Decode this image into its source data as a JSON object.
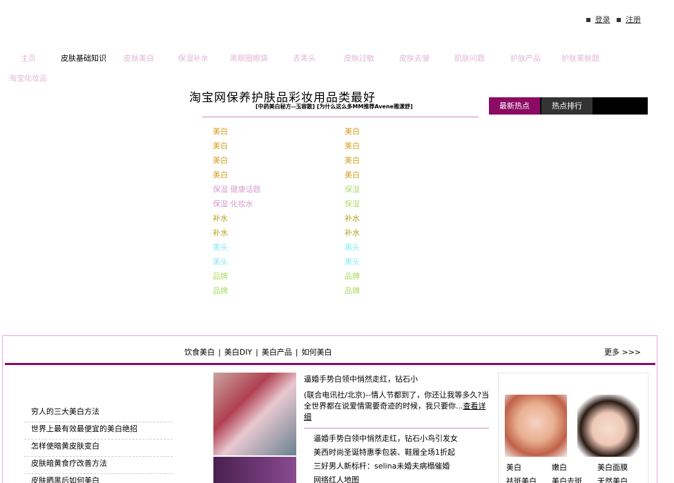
{
  "auth": {
    "login": "登录",
    "register": "注册"
  },
  "nav": {
    "items": [
      "主页",
      "皮肤基础知识",
      "皮肤美白",
      "保湿补水",
      "黑眼圈眼袋",
      "去黑头",
      "皮肤过敏",
      "皮肤去皱",
      "肌肤问题",
      "护肤产品",
      "护肤美肤题"
    ],
    "second_row": "淘宝化妆品"
  },
  "headline": {
    "title": "淘宝网保养护肤品彩妆用品类最好",
    "subtitle": "[中药美白秘方--玉容散] [为什么这么多MM推荐Avene雅漾舒]"
  },
  "hot_tabs": {
    "tab1": "最新热点",
    "tab2": "热点排行"
  },
  "columns": {
    "left": [
      "美白",
      "美白",
      "美白",
      "美白",
      "保湿  健康话题",
      "保湿  化妆水",
      "补水",
      "补水",
      "黑头",
      "黑头",
      "品牌",
      "品牌"
    ],
    "right": [
      "美白",
      "美白",
      "美白",
      "美白",
      "保湿",
      "保湿",
      "补水",
      "补水",
      "黑头",
      "黑头",
      "品牌",
      "品牌"
    ]
  },
  "colors": {
    "accent": "#8c0a63",
    "nav_text": "#e0b8d6",
    "border_pink": "#e4a8d8"
  },
  "panel": {
    "nav": [
      "饮食美白",
      "美白DIY",
      "美白产品",
      "如何美白"
    ],
    "nav_separator": "|",
    "more": "更多 >>>",
    "left_list": [
      "穷人的三大美白方法",
      "世界上最有效最便宜的美白绝招",
      "怎样使暗黄皮肤变白",
      "皮肤暗黄食疗改善方法",
      "皮肤晒黑后如何美白"
    ],
    "news": {
      "title": "逼婚手势白领中悄然走红，钻石小",
      "body": "(联合电讯社/北京)--情人节都到了，你还让我等多久?当全世界都在说爱情需要奇迹的时候，我只要你...",
      "detail_link": "查看详细",
      "list": [
        "逼婚手势白领中悄然走红，钻石小鸟引发女",
        "美西时尚圣诞特惠季包装、鞋履全场1折起",
        "三好男人新标杆：selina未婚夫病榻催婚",
        "网络红人地图"
      ]
    },
    "product_links": [
      "美白",
      "嫩白",
      "美白面膜",
      "祛斑美白",
      "美白去斑",
      "天然美白"
    ]
  }
}
